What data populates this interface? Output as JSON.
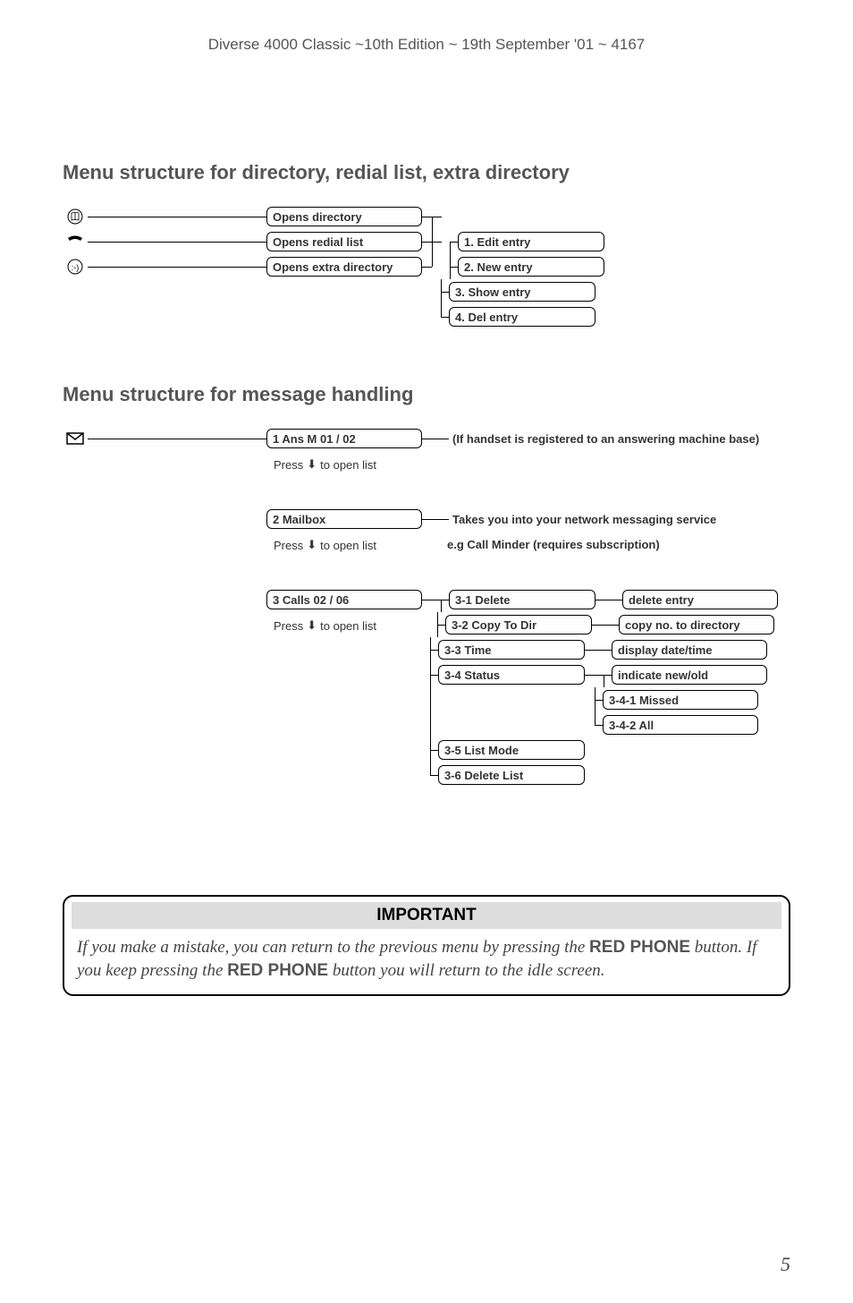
{
  "header": "Diverse 4000 Classic ~10th Edition ~ 19th September '01 ~ 4167",
  "section1_title": "Menu structure for directory, redial list, extra directory",
  "row1_label": "Opens directory",
  "row2_label": "Opens redial list",
  "row3_label": "Opens extra directory",
  "opt1": "1. Edit entry",
  "opt2": "2. New entry",
  "opt3": "3. Show entry",
  "opt4": "4. Del entry",
  "section2_title": "Menu structure for message handling",
  "ans_label": "1 Ans M 01 / 02",
  "ans_note": "(If handset is registered to an answering machine base)",
  "press_open": "Press",
  "press_open_suffix": "to open list",
  "mailbox_label": "2 Mailbox",
  "mailbox_note1": "Takes you into your network messaging service",
  "mailbox_note2": "e.g Call Minder (requires subscription)",
  "calls_label": "3 Calls 02 / 06",
  "c31": "3-1 Delete",
  "c32": "3-2 Copy To Dir",
  "c33": "3-3 Time",
  "c34": "3-4 Status",
  "c35": "3-5 List Mode",
  "c36": "3-6 Delete List",
  "r31": "delete entry",
  "r32": "copy no. to directory",
  "r33": "display date/time",
  "r34": "indicate new/old",
  "r341": "3-4-1 Missed",
  "r342": "3-4-2 All",
  "important_title": "IMPORTANT",
  "imp_a": "If you make a mistake, you can return to the previous menu by pressing the",
  "imp_kw": "RED PHONE",
  "imp_b": "button. If you keep pressing the",
  "imp_c": "button you will return to the idle screen.",
  "page_number": "5",
  "chart_data": {
    "type": "table",
    "title": "Phone menu tree structure",
    "trees": [
      {
        "root": "Opens directory",
        "children": [
          "1. Edit entry",
          "2. New entry",
          "3. Show entry",
          "4. Del entry"
        ]
      },
      {
        "root": "Opens redial list",
        "children": [
          "1. Edit entry",
          "2. New entry",
          "3. Show entry",
          "4. Del entry"
        ]
      },
      {
        "root": "Opens extra directory",
        "children": [
          "1. Edit entry",
          "2. New entry",
          "3. Show entry",
          "4. Del entry"
        ]
      },
      {
        "root": "1 Ans M 01 / 02",
        "note": "If handset is registered to an answering machine base"
      },
      {
        "root": "2 Mailbox",
        "note": "Takes you into your network messaging service e.g Call Minder (requires subscription)"
      },
      {
        "root": "3 Calls 02 / 06",
        "children": [
          {
            "label": "3-1 Delete",
            "result": "delete entry"
          },
          {
            "label": "3-2 Copy To Dir",
            "result": "copy no. to directory"
          },
          {
            "label": "3-3 Time",
            "result": "display date/time"
          },
          {
            "label": "3-4 Status",
            "result": "indicate new/old",
            "children": [
              "3-4-1 Missed",
              "3-4-2 All"
            ]
          },
          {
            "label": "3-5 List Mode"
          },
          {
            "label": "3-6 Delete List"
          }
        ]
      }
    ]
  }
}
